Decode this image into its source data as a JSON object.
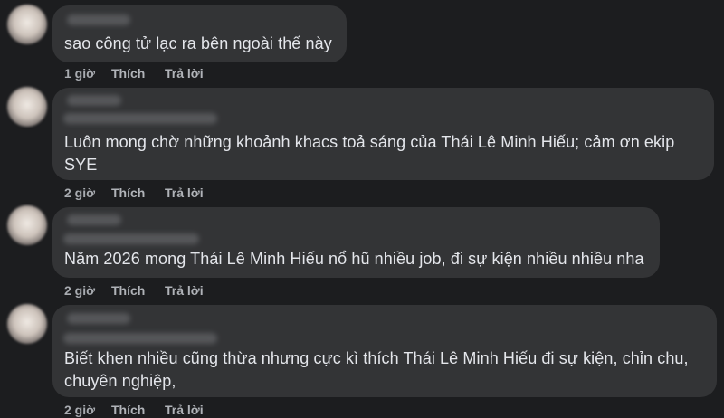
{
  "comments": [
    {
      "text": "sao công tử lạc ra bên ngoài thế này",
      "time": "1 giờ",
      "like": "Thích",
      "reply": "Trả lời"
    },
    {
      "text": "Luôn mong chờ những khoảnh khacs toả sáng của Thái Lê Minh Hiếu; cảm ơn ekip SYE",
      "time": "2 giờ",
      "like": "Thích",
      "reply": "Trả lời"
    },
    {
      "text": "Năm 2026 mong Thái Lê Minh Hiếu nổ hũ nhiều job, đi sự kiện nhiều nhiều nha",
      "time": "2 giờ",
      "like": "Thích",
      "reply": "Trả lời"
    },
    {
      "text": "Biết khen nhiều cũng thừa nhưng cực kì thích Thái Lê Minh Hiếu đi sự kiện, chỉn chu, chuyên nghiệp,",
      "time": "2 giờ",
      "like": "Thích",
      "reply": "Trả lời"
    }
  ],
  "colors": {
    "background": "#1c1d1f",
    "bubble": "#333436",
    "text": "#e4e6eb",
    "meta": "#b0b3b8"
  }
}
